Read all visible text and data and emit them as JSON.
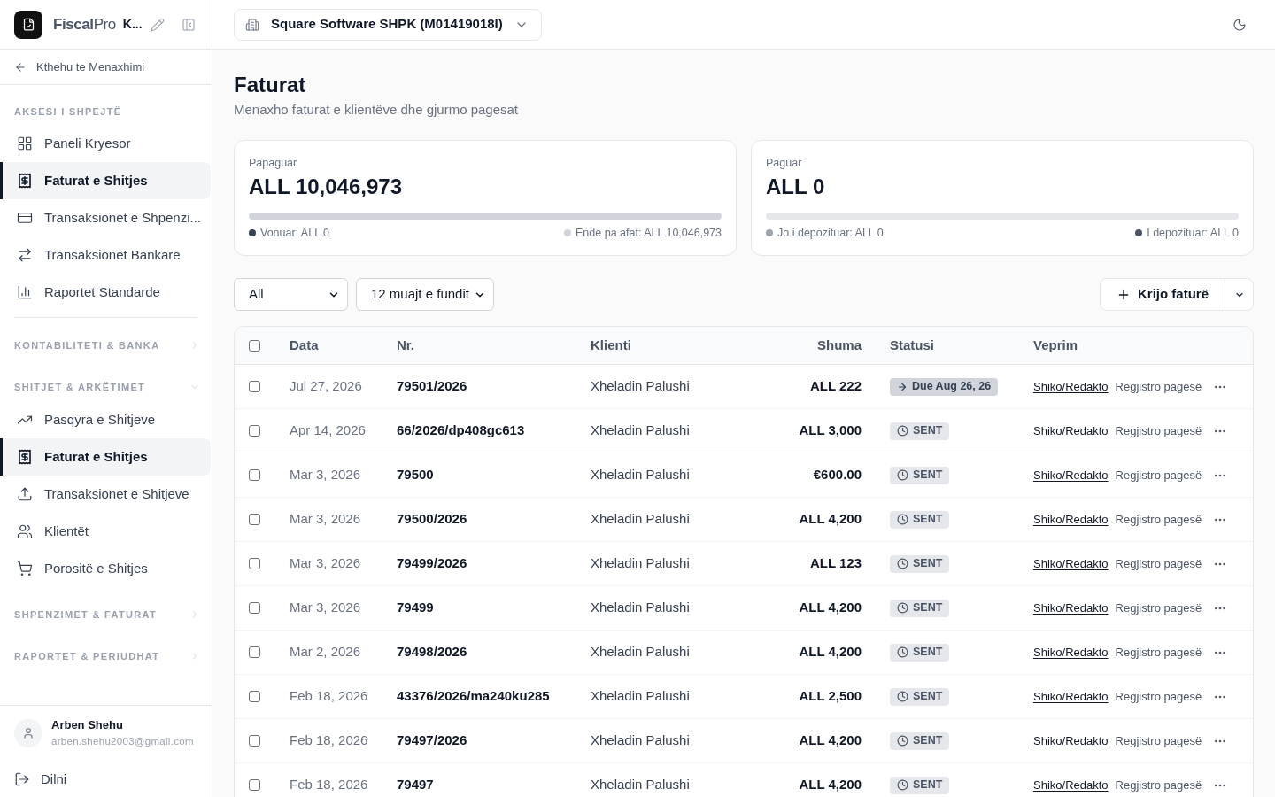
{
  "sidebar": {
    "brand": {
      "name": "**Fiscal**Pro",
      "company_short": "K..."
    },
    "back_link": "Kthehu te Menaxhimi",
    "quick_access": {
      "title": "AKSESI I SHPEJTË",
      "items": [
        {
          "label": "Paneli Kryesor",
          "selected": false
        },
        {
          "label": "Faturat e Shitjes",
          "selected": true
        },
        {
          "label": "Transaksionet e Shpenzi...",
          "selected": false
        },
        {
          "label": "Transaksionet Bankare",
          "selected": false
        },
        {
          "label": "Raportet Standarde",
          "selected": false
        }
      ]
    },
    "sections": [
      {
        "title": "KONTABILITETI & BANKA",
        "expanded": false
      },
      {
        "title": "SHITJET & ARKËTIMET",
        "expanded": true,
        "items": [
          {
            "label": "Pasqyra e Shitjeve",
            "selected": false
          },
          {
            "label": "Faturat e Shitjes",
            "selected": true
          },
          {
            "label": "Transaksionet e Shitjeve",
            "selected": false
          },
          {
            "label": "Klientët",
            "selected": false
          },
          {
            "label": "Porositë e Shitjes",
            "selected": false
          }
        ]
      },
      {
        "title": "SHPENZIMET & FATURAT",
        "expanded": false
      },
      {
        "title": "RAPORTET & PERIUDHAT",
        "expanded": false
      }
    ],
    "user": {
      "name": "Arben Shehu",
      "email": "arben.shehu2003@gmail.com"
    },
    "logout": "Dilni"
  },
  "header": {
    "company": "Square Software SHPK (M01419018I)"
  },
  "page": {
    "title": "Faturat",
    "subtitle": "Menaxho faturat e klientëve dhe gjurmo pagesat"
  },
  "summary_cards": [
    {
      "label": "Papaguar",
      "amount": "ALL 10,046,973",
      "segments": [
        {
          "label": "Vonuar: ALL 0",
          "color": "#374151",
          "level": 0
        },
        {
          "label": "Ende pa afat: ALL 10,046,973",
          "color": "#d1d5db",
          "level": 1
        }
      ]
    },
    {
      "label": "Paguar",
      "amount": "ALL 0",
      "segments": [
        {
          "label": "Jo i depozituar: ALL 0",
          "color": "#9ca3af",
          "level": 0
        },
        {
          "label": "I depozituar: ALL 0",
          "color": "#4b5563",
          "level": 0
        }
      ]
    }
  ],
  "filters": [
    {
      "value": "All"
    },
    {
      "value": "12 muajt e fundit"
    }
  ],
  "create_button": "Krijo faturë",
  "table": {
    "header_checkbox": {
      "checked": false
    },
    "columns": [
      "Data",
      "Nr.",
      "Klienti",
      "Shuma",
      "Statusi",
      "Veprim"
    ],
    "rows": [
      {
        "checked": false,
        "date": "Jul 27, 2026",
        "number": "79501/2026",
        "client": "Xheladin Palushi",
        "amount": "ALL 222",
        "status": {
          "kind": "due",
          "label": "Due Aug 26, 26"
        },
        "actions": [
          "Shiko/Redakto",
          "Regjistro pagesë"
        ]
      },
      {
        "checked": false,
        "date": "Apr 14, 2026",
        "number": "66/2026/dp408gc613",
        "client": "Xheladin Palushi",
        "amount": "ALL 3,000",
        "status": {
          "kind": "sent",
          "label": "SENT"
        },
        "actions": [
          "Shiko/Redakto",
          "Regjistro pagesë"
        ]
      },
      {
        "checked": false,
        "date": "Mar 3, 2026",
        "number": "79500",
        "client": "Xheladin Palushi",
        "amount": "€600.00",
        "status": {
          "kind": "sent",
          "label": "SENT"
        },
        "actions": [
          "Shiko/Redakto",
          "Regjistro pagesë"
        ]
      },
      {
        "checked": false,
        "date": "Mar 3, 2026",
        "number": "79500/2026",
        "client": "Xheladin Palushi",
        "amount": "ALL 4,200",
        "status": {
          "kind": "sent",
          "label": "SENT"
        },
        "actions": [
          "Shiko/Redakto",
          "Regjistro pagesë"
        ]
      },
      {
        "checked": false,
        "date": "Mar 3, 2026",
        "number": "79499/2026",
        "client": "Xheladin Palushi",
        "amount": "ALL 123",
        "status": {
          "kind": "sent",
          "label": "SENT"
        },
        "actions": [
          "Shiko/Redakto",
          "Regjistro pagesë"
        ]
      },
      {
        "checked": false,
        "date": "Mar 3, 2026",
        "number": "79499",
        "client": "Xheladin Palushi",
        "amount": "ALL 4,200",
        "status": {
          "kind": "sent",
          "label": "SENT"
        },
        "actions": [
          "Shiko/Redakto",
          "Regjistro pagesë"
        ]
      },
      {
        "checked": false,
        "date": "Mar 2, 2026",
        "number": "79498/2026",
        "client": "Xheladin Palushi",
        "amount": "ALL 4,200",
        "status": {
          "kind": "sent",
          "label": "SENT"
        },
        "actions": [
          "Shiko/Redakto",
          "Regjistro pagesë"
        ]
      },
      {
        "checked": false,
        "date": "Feb 18, 2026",
        "number": "43376/2026/ma240ku285",
        "client": "Xheladin Palushi",
        "amount": "ALL 2,500",
        "status": {
          "kind": "sent",
          "label": "SENT"
        },
        "actions": [
          "Shiko/Redakto",
          "Regjistro pagesë"
        ]
      },
      {
        "checked": false,
        "date": "Feb 18, 2026",
        "number": "79497/2026",
        "client": "Xheladin Palushi",
        "amount": "ALL 4,200",
        "status": {
          "kind": "sent",
          "label": "SENT"
        },
        "actions": [
          "Shiko/Redakto",
          "Regjistro pagesë"
        ]
      },
      {
        "checked": false,
        "date": "Feb 18, 2026",
        "number": "79497",
        "client": "Xheladin Palushi",
        "amount": "ALL 4,200",
        "status": {
          "kind": "sent",
          "label": "SENT"
        },
        "actions": [
          "Shiko/Redakto",
          "Regjistro pagesë"
        ]
      }
    ]
  }
}
